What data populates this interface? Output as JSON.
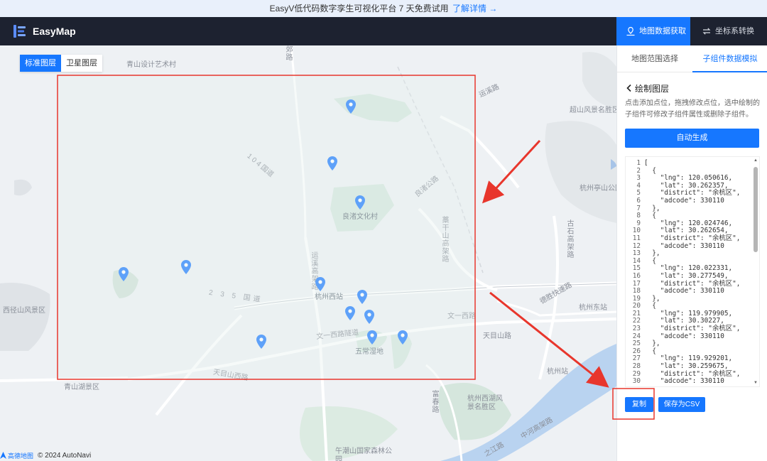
{
  "banner": {
    "text": "EasyV低代码数字孪生可视化平台 7 天免费试用",
    "link": "了解详情 →"
  },
  "header": {
    "brand": "EasyMap",
    "nav": [
      {
        "label": "地图数据获取",
        "icon": "map-data-icon",
        "active": true
      },
      {
        "label": "坐标系转换",
        "icon": "convert-icon",
        "active": false
      }
    ]
  },
  "map": {
    "layer_tabs": [
      {
        "label": "标准图层",
        "active": true
      },
      {
        "label": "卫星图层",
        "active": false
      }
    ],
    "labels": {
      "qingshan": "青山设计艺术村",
      "jiaolu": "郊路",
      "yungang": "运溪路",
      "chaoshan": "超山风景名胜区",
      "r104": "1 0 4 国道",
      "liangzhu_road": "良渚公路",
      "liangzhu_village": "良渚文化村",
      "hangzhou_qinggong": "杭州亭山公园",
      "shiershan": "藁干山高架路",
      "shidiao": "石大线",
      "gaoshan": "古石高架路",
      "xixi_west": "西径山风景区",
      "r235": "2 3 5 国道",
      "hangzhou_west": "杭州西站",
      "yunhe": "运溪高架路",
      "wenyi_tunnel": "文一西路隧道",
      "wenyi_west": "文一西路",
      "tianmushan": "天目山路",
      "wuchang": "五常湿地",
      "tianmushan_west": "天目山西路",
      "deshengkuai": "德胜快速路",
      "hangzhou_east": "杭州东站",
      "hangzhou_station": "杭州站",
      "qingshanhu": "青山湖景区",
      "west_lake": "杭州西湖风景名胜区",
      "zhijiang": "之江路",
      "fuchun": "富春路",
      "wuyun": "午潮山国家森林公园",
      "shangtang": "上塘高架路",
      "zhonghe": "中河高架路"
    },
    "attribution": {
      "logo": "高德地图",
      "text": "© 2024 AutoNavi"
    }
  },
  "panel": {
    "tabs": [
      {
        "label": "地图范围选择",
        "active": false
      },
      {
        "label": "子组件数据模拟",
        "active": true
      }
    ],
    "back_title": "绘制图层",
    "description": "点击添加点位，拖拽修改点位，选中绘制的子组件可修改子组件属性或删除子组件。",
    "auto_button": "自动生成",
    "code_lines": [
      "[",
      "  {",
      "    \"lng\": 120.050616,",
      "    \"lat\": 30.262357,",
      "    \"district\": \"余杭区\",",
      "    \"adcode\": 330110",
      "  },",
      "  {",
      "    \"lng\": 120.024746,",
      "    \"lat\": 30.262654,",
      "    \"district\": \"余杭区\",",
      "    \"adcode\": 330110",
      "  },",
      "  {",
      "    \"lng\": 120.022331,",
      "    \"lat\": 30.277549,",
      "    \"district\": \"余杭区\",",
      "    \"adcode\": 330110",
      "  },",
      "  {",
      "    \"lng\": 119.979905,",
      "    \"lat\": 30.30227,",
      "    \"district\": \"余杭区\",",
      "    \"adcode\": 330110",
      "  },",
      "  {",
      "    \"lng\": 119.929201,",
      "    \"lat\": 30.259675,",
      "    \"district\": \"余杭区\",",
      "    \"adcode\": 330110"
    ],
    "copy_button": "复制",
    "csv_button": "保存为CSV"
  },
  "colors": {
    "accent": "#1677ff",
    "annotation": "#e8362c",
    "header_bg": "#1d2230",
    "map_bg": "#eef1f4"
  }
}
